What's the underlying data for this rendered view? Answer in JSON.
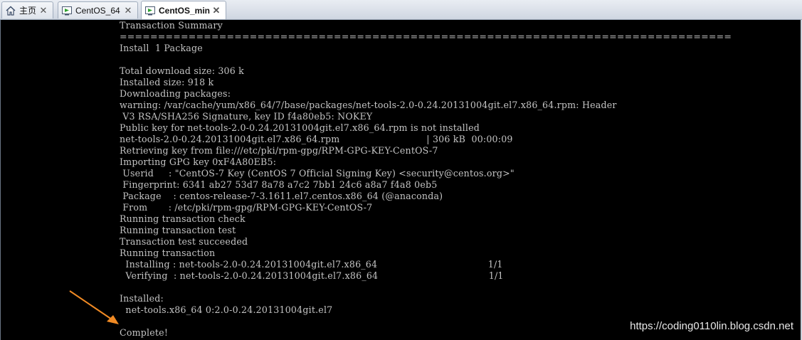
{
  "tabs": [
    {
      "label": "主页",
      "icon": "home-icon",
      "active": false
    },
    {
      "label": "CentOS_64",
      "icon": "vm-icon",
      "active": false
    },
    {
      "label": "CentOS_min",
      "icon": "vm-icon",
      "active": true
    }
  ],
  "terminal_lines": [
    "Transaction Summary",
    "================================================================================",
    "Install  1 Package",
    "",
    "Total download size: 306 k",
    "Installed size: 918 k",
    "Downloading packages:",
    "warning: /var/cache/yum/x86_64/7/base/packages/net-tools-2.0-0.24.20131004git.el7.x86_64.rpm: Header",
    " V3 RSA/SHA256 Signature, key ID f4a80eb5: NOKEY",
    "Public key for net-tools-2.0-0.24.20131004git.el7.x86_64.rpm is not installed",
    "net-tools-2.0-0.24.20131004git.el7.x86_64.rpm                             | 306 kB  00:00:09",
    "Retrieving key from file:///etc/pki/rpm-gpg/RPM-GPG-KEY-CentOS-7",
    "Importing GPG key 0xF4A80EB5:",
    " Userid     : \"CentOS-7 Key (CentOS 7 Official Signing Key) <security@centos.org>\"",
    " Fingerprint: 6341 ab27 53d7 8a78 a7c2 7bb1 24c6 a8a7 f4a8 0eb5",
    " Package    : centos-release-7-3.1611.el7.centos.x86_64 (@anaconda)",
    " From       : /etc/pki/rpm-gpg/RPM-GPG-KEY-CentOS-7",
    "Running transaction check",
    "Running transaction test",
    "Transaction test succeeded",
    "Running transaction",
    "  Installing : net-tools-2.0-0.24.20131004git.el7.x86_64                                     1/1",
    "  Verifying  : net-tools-2.0-0.24.20131004git.el7.x86_64                                     1/1",
    "",
    "Installed:",
    "  net-tools.x86_64 0:2.0-0.24.20131004git.el7",
    "",
    "Complete!"
  ],
  "watermark": "https://coding0110lin.blog.csdn.net",
  "colors": {
    "terminal_bg": "#000000",
    "terminal_text": "#c4c4c4",
    "annotation_arrow": "#f08a24"
  }
}
